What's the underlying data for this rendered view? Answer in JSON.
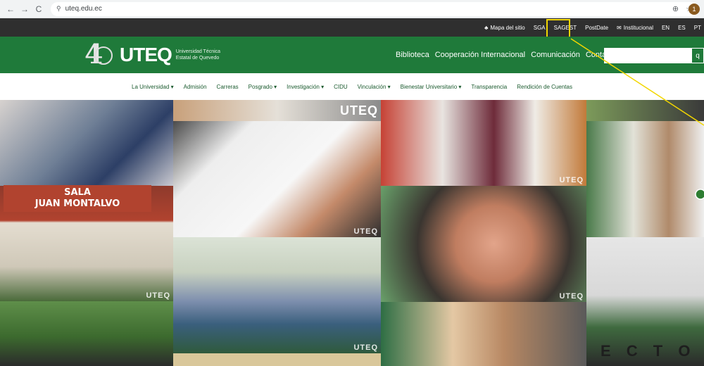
{
  "browser": {
    "back_icon": "←",
    "forward_icon": "→",
    "reload_icon": "C",
    "url": "uteq.edu.ec",
    "zoom_icon": "⊕",
    "star_icon": "☆",
    "profile_initial": "1"
  },
  "utility": {
    "items": [
      {
        "icon": "sitemap-icon",
        "label": "Mapa del sitio"
      },
      {
        "label": "SGA"
      },
      {
        "label": "SAGEST"
      },
      {
        "label": "PostDate"
      },
      {
        "icon": "mail-icon",
        "label": "Institucional"
      },
      {
        "label": "EN"
      },
      {
        "label": "ES"
      },
      {
        "label": "PT"
      }
    ]
  },
  "header": {
    "logo_text": "UTEQ",
    "logo_number": "4",
    "logo_sub_line1": "Universidad Técnica",
    "logo_sub_line2": "Estatal de Quevedo",
    "nav": [
      "Biblioteca",
      "Cooperación Internacional",
      "Comunicación",
      "Contacto"
    ],
    "search_placeholder": "",
    "search_icon": "q"
  },
  "subnav": {
    "items": [
      "La Universidad ▾",
      "Admisión",
      "Carreras",
      "Posgrado ▾",
      "Investigación ▾",
      "CIDU",
      "Vinculación ▾",
      "Bienestar Universitario ▾",
      "Transparencia",
      "Rendición de Cuentas"
    ]
  },
  "gallery": {
    "sign_line1": "SALA",
    "sign_line2": "JUAN MONTALVO",
    "stamp": "UTEQ",
    "bottom_letters": "E C T O"
  },
  "colors": {
    "brand_green": "#1f7a3a",
    "utility_bg": "#2f2f2f",
    "highlight": "#f2d600"
  }
}
